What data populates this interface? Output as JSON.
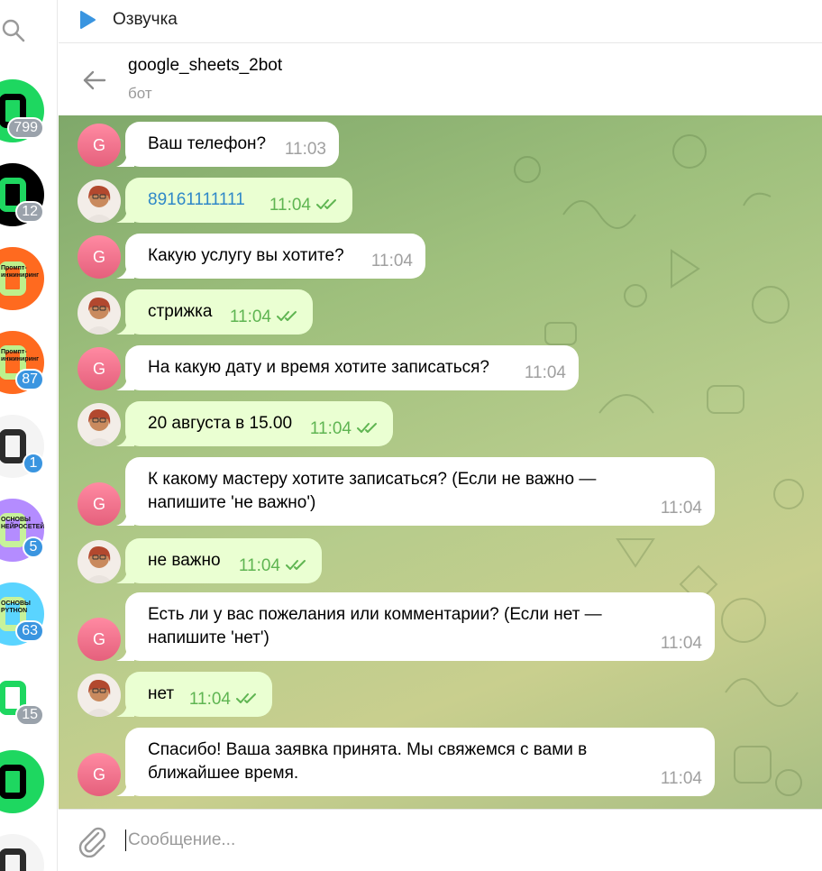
{
  "topbar": {
    "title": "Озвучка",
    "icon": "play-icon"
  },
  "header": {
    "name": "google_sheets_2bot",
    "status": "бот"
  },
  "sidebar": {
    "chats": [
      {
        "badge": "799",
        "badge_style": "grey",
        "colors": [
          "#1ed760",
          "#000"
        ],
        "thumb_text": ""
      },
      {
        "badge": "12",
        "badge_style": "grey",
        "colors": [
          "#000",
          "#1ed760"
        ],
        "thumb_text": ""
      },
      {
        "badge": "",
        "badge_style": "",
        "colors": [
          "#ff6a1f",
          "#bdf08c"
        ],
        "thumb_text": "Промпт-инжиниринг"
      },
      {
        "badge": "87",
        "badge_style": "blue",
        "colors": [
          "#ff6a1f",
          "#bdf08c"
        ],
        "thumb_text": "Промпт-инжиниринг"
      },
      {
        "badge": "1",
        "badge_style": "blue",
        "colors": [
          "#f4f4f4",
          "#2b2b2b"
        ],
        "thumb_text": ""
      },
      {
        "badge": "5",
        "badge_style": "blue",
        "colors": [
          "#b48cff",
          "#c7f29a"
        ],
        "thumb_text": "ОСНОВЫ НЕЙРОСЕТЕЙ"
      },
      {
        "badge": "63",
        "badge_style": "blue",
        "colors": [
          "#5ad4ff",
          "#c7f29a"
        ],
        "thumb_text": "ОСНОВЫ PYTHON"
      },
      {
        "badge": "15",
        "badge_style": "grey",
        "colors": [
          "#fff",
          "#1ed760"
        ],
        "thumb_text": ""
      },
      {
        "badge": "",
        "badge_style": "",
        "colors": [
          "#1ed760",
          "#000"
        ],
        "thumb_text": ""
      },
      {
        "badge": "",
        "badge_style": "",
        "colors": [
          "#f4f4f4",
          "#2b2b2b"
        ],
        "thumb_text": ""
      }
    ]
  },
  "messages": [
    {
      "from": "bot",
      "avatar_letter": "G",
      "lines": [
        "Ваш телефон?"
      ],
      "time": "11:03"
    },
    {
      "from": "user",
      "lines": [
        "89161111111"
      ],
      "time": "11:04",
      "is_phone": true
    },
    {
      "from": "bot",
      "avatar_letter": "G",
      "lines": [
        "Какую услугу вы хотите?"
      ],
      "time": "11:04"
    },
    {
      "from": "user",
      "lines": [
        "стрижка"
      ],
      "time": "11:04"
    },
    {
      "from": "bot",
      "avatar_letter": "G",
      "lines": [
        "На какую дату и время хотите записаться?"
      ],
      "time": "11:04"
    },
    {
      "from": "user",
      "lines": [
        "20 августа в 15.00"
      ],
      "time": "11:04"
    },
    {
      "from": "bot",
      "avatar_letter": "G",
      "lines": [
        "К какому мастеру хотите записаться? (Если не важно —",
        "напишите 'не важно')"
      ],
      "time": "11:04"
    },
    {
      "from": "user",
      "lines": [
        "не важно"
      ],
      "time": "11:04"
    },
    {
      "from": "bot",
      "avatar_letter": "G",
      "lines": [
        "Есть ли у вас пожелания или комментарии? (Если нет —",
        "напишите 'нет')"
      ],
      "time": "11:04"
    },
    {
      "from": "user",
      "lines": [
        "нет"
      ],
      "time": "11:04"
    },
    {
      "from": "bot",
      "avatar_letter": "G",
      "lines": [
        "Спасибо! Ваша заявка принята. Мы свяжемся с вами в",
        "ближайшее время."
      ],
      "time": "11:04"
    }
  ],
  "composer": {
    "placeholder": "Сообщение..."
  },
  "colors": {
    "accent": "#3a95e0",
    "out_bubble": "#eaffd2",
    "bot_avatar": "#f07790",
    "read_ticks": "#5fb552"
  }
}
